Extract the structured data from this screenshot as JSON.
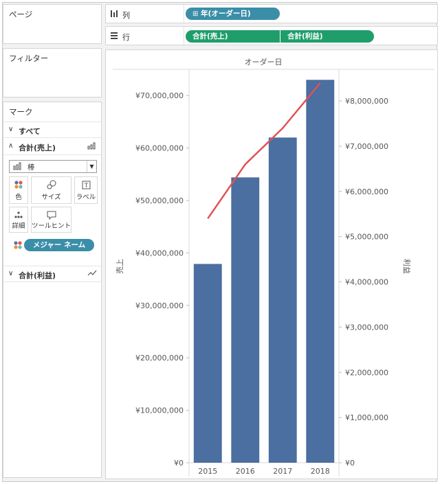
{
  "pages_card": {
    "title": "ページ"
  },
  "filters_card": {
    "title": "フィルター"
  },
  "marks_card": {
    "title": "マーク",
    "all_label": "すべて",
    "sum_sales_label": "合計(売上)",
    "mark_type": "棒",
    "buttons": {
      "color": "色",
      "size": "サイズ",
      "label": "ラベル",
      "detail": "詳細",
      "tooltip": "ツールヒント"
    },
    "measure_names_pill": "メジャー ネーム",
    "sum_profit_label": "合計(利益)"
  },
  "columns_shelf": {
    "label": "列",
    "pill": "年(オーダー日)"
  },
  "rows_shelf": {
    "label": "行",
    "pills": [
      "合計(売上)",
      "合計(利益)"
    ]
  },
  "colors": {
    "bar": "#4a6fa0",
    "line": "#e05255",
    "pill_blue": "#3a8ea8",
    "pill_green": "#1f9e6c"
  },
  "chart_data": {
    "type": "bar",
    "title": "オーダー日",
    "categories": [
      "2015",
      "2016",
      "2017",
      "2018"
    ],
    "series": [
      {
        "name": "売上",
        "type": "bar",
        "axis": "left",
        "values": [
          37900000,
          54400000,
          62000000,
          73000000
        ]
      },
      {
        "name": "利益",
        "type": "line",
        "axis": "right",
        "values": [
          5400000,
          6600000,
          7400000,
          8400000
        ]
      }
    ],
    "left_axis": {
      "label": "売上",
      "ylim": [
        0,
        75000000
      ],
      "ticks": [
        "¥0",
        "¥10,000,000",
        "¥20,000,000",
        "¥30,000,000",
        "¥40,000,000",
        "¥50,000,000",
        "¥60,000,000",
        "¥70,000,000"
      ],
      "tick_values": [
        0,
        10000000,
        20000000,
        30000000,
        40000000,
        50000000,
        60000000,
        70000000
      ]
    },
    "right_axis": {
      "label": "利益",
      "ylim": [
        0,
        8700000
      ],
      "ticks": [
        "¥0",
        "¥1,000,000",
        "¥2,000,000",
        "¥3,000,000",
        "¥4,000,000",
        "¥5,000,000",
        "¥6,000,000",
        "¥7,000,000",
        "¥8,000,000"
      ],
      "tick_values": [
        0,
        1000000,
        2000000,
        3000000,
        4000000,
        5000000,
        6000000,
        7000000,
        8000000
      ]
    }
  }
}
